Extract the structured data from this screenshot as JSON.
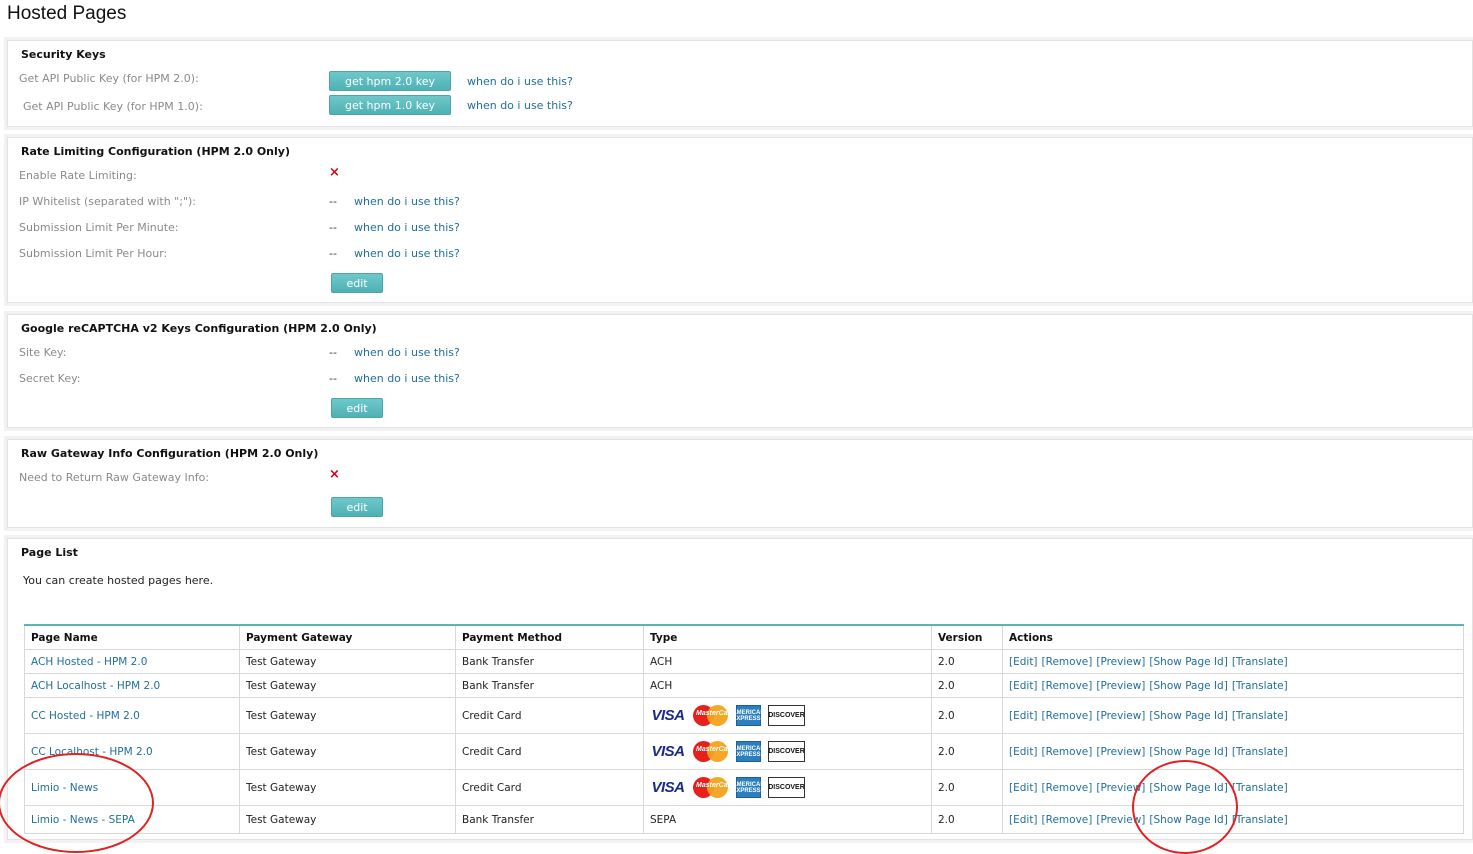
{
  "page_title": "Hosted Pages",
  "security": {
    "title": "Security Keys",
    "rows": [
      {
        "label": "Get API Public Key (for HPM 2.0):",
        "button": "get hpm 2.0 key",
        "link": "when do i use this?"
      },
      {
        "label": "Get API Public Key (for HPM 1.0):",
        "button": "get hpm 1.0 key",
        "link": "when do i use this?"
      }
    ]
  },
  "rate": {
    "title": "Rate Limiting Configuration (HPM 2.0 Only)",
    "enable_label": "Enable Rate Limiting:",
    "enable_value": "×",
    "rows": [
      {
        "label": "IP Whitelist (separated with \";\"):",
        "value": "--",
        "link": "when do i use this?"
      },
      {
        "label": "Submission Limit Per Minute:",
        "value": "--",
        "link": "when do i use this?"
      },
      {
        "label": "Submission Limit Per Hour:",
        "value": "--",
        "link": "when do i use this?"
      }
    ],
    "edit": "edit"
  },
  "recaptcha": {
    "title": "Google reCAPTCHA v2 Keys Configuration (HPM 2.0 Only)",
    "rows": [
      {
        "label": "Site Key:",
        "value": "--",
        "link": "when do i use this?"
      },
      {
        "label": "Secret Key:",
        "value": "--",
        "link": "when do i use this?"
      }
    ],
    "edit": "edit"
  },
  "raw": {
    "title": "Raw Gateway Info Configuration (HPM 2.0 Only)",
    "label": "Need to Return Raw Gateway Info:",
    "value": "×",
    "edit": "edit"
  },
  "page_list": {
    "title": "Page List",
    "description": "You can create hosted pages here.",
    "columns": [
      "Page Name",
      "Payment Gateway",
      "Payment Method",
      "Type",
      "Version",
      "Actions"
    ],
    "rows": [
      {
        "name": "ACH Hosted - HPM 2.0",
        "gateway": "Test Gateway",
        "method": "Bank Transfer",
        "type": "ACH",
        "version": "2.0"
      },
      {
        "name": "ACH Localhost - HPM 2.0",
        "gateway": "Test Gateway",
        "method": "Bank Transfer",
        "type": "ACH",
        "version": "2.0"
      },
      {
        "name": "CC Hosted - HPM 2.0",
        "gateway": "Test Gateway",
        "method": "Credit Card",
        "type": "",
        "version": "2.0"
      },
      {
        "name": "CC Localhost - HPM 2.0",
        "gateway": "Test Gateway",
        "method": "Credit Card",
        "type": "",
        "version": "2.0"
      },
      {
        "name": "Limio - News",
        "gateway": "Test Gateway",
        "method": "Credit Card",
        "type": "",
        "version": "2.0"
      },
      {
        "name": "Limio - News - SEPA",
        "gateway": "Test Gateway",
        "method": "Bank Transfer",
        "type": "SEPA",
        "version": "2.0"
      }
    ],
    "actions": [
      "[Edit]",
      "[Remove]",
      "[Preview]",
      "[Show Page Id]",
      "[Translate]"
    ],
    "card_labels": {
      "visa": "VISA",
      "mastercard": "MasterCard",
      "amex": "AMERICAN EXPRESS",
      "discover": "DISCOVER"
    }
  }
}
